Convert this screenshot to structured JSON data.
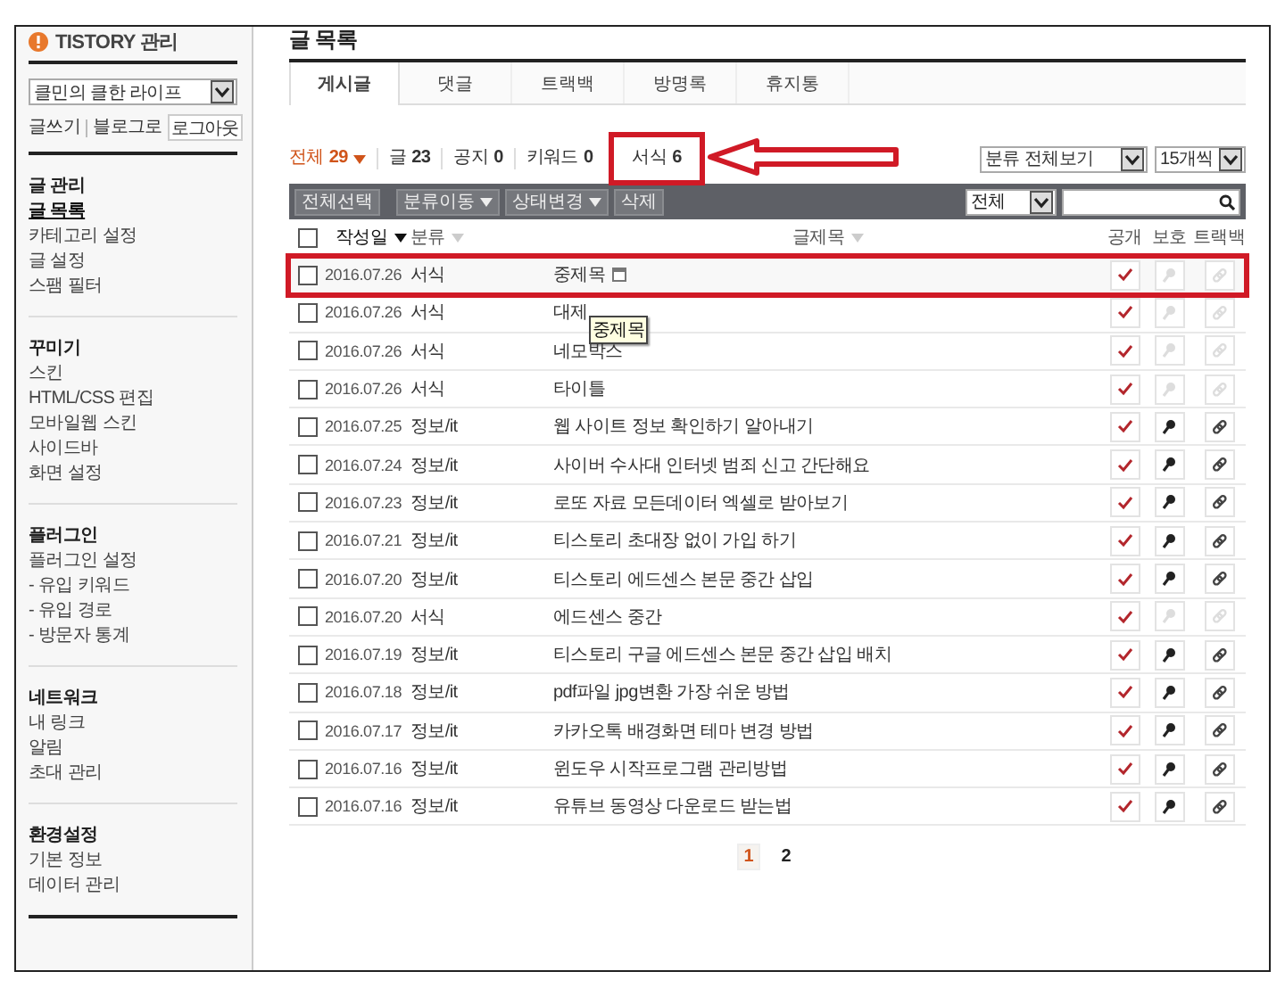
{
  "sidebar": {
    "logo": "TISTORY 관리",
    "blog_select": "클민의 클한 라이프",
    "links": [
      "글쓰기",
      "블로그로"
    ],
    "logout_button": "로그아웃",
    "sections": [
      {
        "title": "글 관리",
        "items": [
          {
            "label": "글 목록",
            "selected": true
          },
          {
            "label": "카테고리 설정",
            "selected": false
          },
          {
            "label": "글 설정",
            "selected": false
          },
          {
            "label": "스팸 필터",
            "selected": false
          }
        ]
      },
      {
        "title": "꾸미기",
        "items": [
          {
            "label": "스킨",
            "selected": false
          },
          {
            "label": "HTML/CSS 편집",
            "selected": false
          },
          {
            "label": "모바일웹 스킨",
            "selected": false
          },
          {
            "label": "사이드바",
            "selected": false
          },
          {
            "label": "화면 설정",
            "selected": false
          }
        ]
      },
      {
        "title": "플러그인",
        "items": [
          {
            "label": "플러그인 설정",
            "selected": false
          },
          {
            "label": "- 유입 키워드",
            "selected": false
          },
          {
            "label": "- 유입 경로",
            "selected": false
          },
          {
            "label": "- 방문자 통계",
            "selected": false
          }
        ]
      },
      {
        "title": "네트워크",
        "items": [
          {
            "label": "내 링크",
            "selected": false
          },
          {
            "label": "알림",
            "selected": false
          },
          {
            "label": "초대 관리",
            "selected": false
          }
        ]
      },
      {
        "title": "환경설정",
        "items": [
          {
            "label": "기본 정보",
            "selected": false
          },
          {
            "label": "데이터 관리",
            "selected": false
          }
        ]
      }
    ]
  },
  "page_title": "글 목록",
  "tabs": [
    {
      "label": "게시글",
      "selected": true
    },
    {
      "label": "댓글",
      "selected": false
    },
    {
      "label": "트랙백",
      "selected": false
    },
    {
      "label": "방명록",
      "selected": false
    },
    {
      "label": "휴지통",
      "selected": false
    }
  ],
  "counts": [
    {
      "label": "전체",
      "count": "29",
      "selected": true,
      "highlighted": false
    },
    {
      "label": "글",
      "count": "23",
      "selected": false,
      "highlighted": false
    },
    {
      "label": "공지",
      "count": "0",
      "selected": false,
      "highlighted": false
    },
    {
      "label": "키워드",
      "count": "0",
      "selected": false,
      "highlighted": false
    },
    {
      "label": "서식",
      "count": "6",
      "selected": false,
      "highlighted": true
    }
  ],
  "category_select": "분류 전체보기",
  "per_page_select": "15개씩",
  "toolbar": {
    "buttons": [
      {
        "label": "전체선택",
        "dropdown": false
      },
      {
        "label": "분류이동",
        "dropdown": true
      },
      {
        "label": "상태변경",
        "dropdown": true
      },
      {
        "label": "삭제",
        "dropdown": false
      }
    ],
    "search_scope": "전체"
  },
  "select_all_checked": false,
  "columns": [
    {
      "label": "작성일",
      "sortable": true,
      "active": true
    },
    {
      "label": "분류",
      "sortable": true,
      "active": false
    },
    {
      "label": "글제목",
      "sortable": true,
      "active": false
    },
    {
      "label": "공개",
      "sortable": false,
      "active": false
    },
    {
      "label": "보호",
      "sortable": false,
      "active": false
    },
    {
      "label": "트랙백",
      "sortable": false,
      "active": false
    }
  ],
  "rows": [
    {
      "date": "2016.07.26",
      "category": "서식",
      "title": "중제목",
      "has_icon": true,
      "public": true,
      "protected": false,
      "trackback": false,
      "highlighted": true
    },
    {
      "date": "2016.07.26",
      "category": "서식",
      "title": "대제",
      "has_icon": false,
      "public": true,
      "protected": false,
      "trackback": false,
      "highlighted": false,
      "tooltip": "중제목"
    },
    {
      "date": "2016.07.26",
      "category": "서식",
      "title": "네모박스",
      "has_icon": false,
      "public": true,
      "protected": false,
      "trackback": false,
      "highlighted": false
    },
    {
      "date": "2016.07.26",
      "category": "서식",
      "title": "타이틀",
      "has_icon": false,
      "public": true,
      "protected": false,
      "trackback": false,
      "highlighted": false
    },
    {
      "date": "2016.07.25",
      "category": "정보/it",
      "title": "웹 사이트 정보 확인하기 알아내기",
      "has_icon": false,
      "public": true,
      "protected": true,
      "trackback": true,
      "highlighted": false
    },
    {
      "date": "2016.07.24",
      "category": "정보/it",
      "title": "사이버 수사대 인터넷 범죄 신고 간단해요",
      "has_icon": false,
      "public": true,
      "protected": true,
      "trackback": true,
      "highlighted": false
    },
    {
      "date": "2016.07.23",
      "category": "정보/it",
      "title": "로또 자료 모든데이터 엑셀로 받아보기",
      "has_icon": false,
      "public": true,
      "protected": true,
      "trackback": true,
      "highlighted": false
    },
    {
      "date": "2016.07.21",
      "category": "정보/it",
      "title": "티스토리 초대장 없이 가입 하기",
      "has_icon": false,
      "public": true,
      "protected": true,
      "trackback": true,
      "highlighted": false
    },
    {
      "date": "2016.07.20",
      "category": "정보/it",
      "title": "티스토리 에드센스 본문 중간 삽입",
      "has_icon": false,
      "public": true,
      "protected": true,
      "trackback": true,
      "highlighted": false
    },
    {
      "date": "2016.07.20",
      "category": "서식",
      "title": "에드센스 중간",
      "has_icon": false,
      "public": true,
      "protected": false,
      "trackback": false,
      "highlighted": false
    },
    {
      "date": "2016.07.19",
      "category": "정보/it",
      "title": "티스토리 구글 에드센스 본문 중간 삽입 배치",
      "has_icon": false,
      "public": true,
      "protected": true,
      "trackback": true,
      "highlighted": false
    },
    {
      "date": "2016.07.18",
      "category": "정보/it",
      "title": "pdf파일 jpg변환 가장 쉬운 방법",
      "has_icon": false,
      "public": true,
      "protected": true,
      "trackback": true,
      "highlighted": false
    },
    {
      "date": "2016.07.17",
      "category": "정보/it",
      "title": "카카오톡 배경화면 테마 변경 방법",
      "has_icon": false,
      "public": true,
      "protected": true,
      "trackback": true,
      "highlighted": false
    },
    {
      "date": "2016.07.16",
      "category": "정보/it",
      "title": "윈도우 시작프로그램 관리방법",
      "has_icon": false,
      "public": true,
      "protected": true,
      "trackback": true,
      "highlighted": false
    },
    {
      "date": "2016.07.16",
      "category": "정보/it",
      "title": "유튜브 동영상 다운로드 받는법",
      "has_icon": false,
      "public": true,
      "protected": true,
      "trackback": true,
      "highlighted": false
    }
  ],
  "pagination": [
    {
      "label": "1",
      "selected": true
    },
    {
      "label": "2",
      "selected": false
    }
  ]
}
